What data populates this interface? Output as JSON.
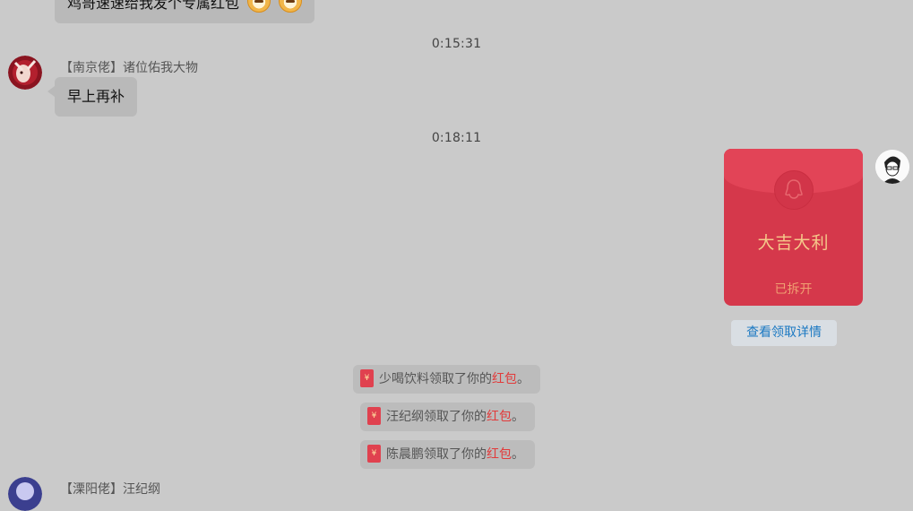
{
  "messages": {
    "top_partial": {
      "text": "鸡哥速速给我发个专属红包"
    },
    "time1": "0:15:31",
    "nanjing": {
      "sender": "【南京佬】诸位佑我大物",
      "text": "早上再补"
    },
    "time2": "0:18:11",
    "red_packet": {
      "title": "大吉大利",
      "status": "已拆开",
      "detail_button": "查看领取详情"
    },
    "notices": [
      {
        "name": "少喝饮料",
        "middle": "领取了你的",
        "link": "红包",
        "end": "。"
      },
      {
        "name": "汪纪纲",
        "middle": "领取了你的",
        "link": "红包",
        "end": "。"
      },
      {
        "name": "陈晨鹏",
        "middle": "领取了你的",
        "link": "红包",
        "end": "。"
      }
    ],
    "bottom_partial": {
      "sender": "【溧阳佬】汪纪纲"
    }
  },
  "colors": {
    "background": "#cacaca",
    "packet_red": "#d5384b",
    "packet_gold": "#f5c98a",
    "link_red": "#e23a3a",
    "detail_blue": "#1a78c2"
  },
  "icons": {
    "emoji": "doge-emoji-icon",
    "qq": "penguin-icon",
    "mini_packet": "red-packet-icon"
  }
}
